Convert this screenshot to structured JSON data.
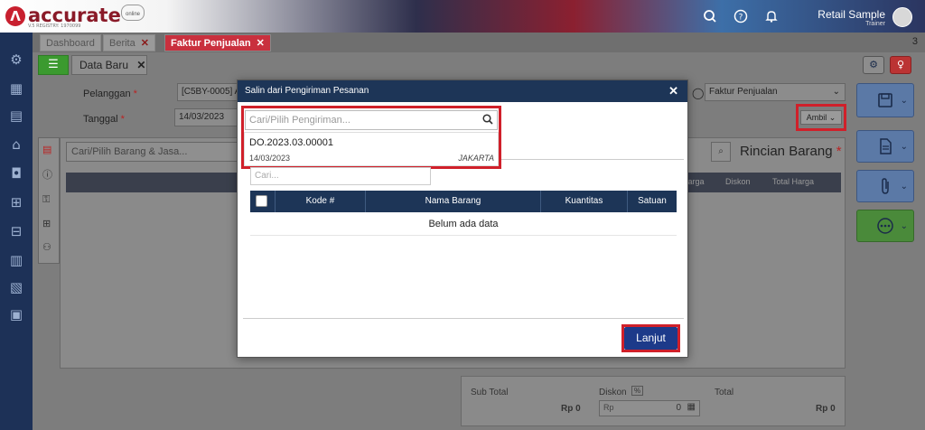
{
  "app": {
    "logo_text": "accurate",
    "logo_sub": "V.5 REGISTRY: 1970099",
    "logo_online": "online",
    "user_name": "Retail Sample",
    "user_role": "Trainer"
  },
  "tabs": [
    {
      "label": "Dashboard",
      "closable": false
    },
    {
      "label": "Berita",
      "closable": true
    },
    {
      "label": "Faktur Penjualan",
      "closable": true,
      "active": true
    }
  ],
  "tab_count": "3",
  "form": {
    "subtab_label": "Data Baru",
    "customer_label": "Pelanggan",
    "customer_value": "[C5BY-0005] Ab",
    "date_label": "Tanggal",
    "date_value": "14/03/2023",
    "doc_type_value": "Faktur Penjualan",
    "ambil_label": "Ambil",
    "item_search_placeholder": "Cari/Pilih Barang & Jasa...",
    "rincian_label": "Rincian Barang",
    "col_harga": "Harga",
    "col_diskon": "Diskon",
    "col_total": "Total Harga"
  },
  "summary": {
    "subtotal_label": "Sub Total",
    "subtotal_value": "Rp 0",
    "diskon_label": "Diskon",
    "diskon_badge": "%",
    "diskon_prefix": "Rp",
    "diskon_value": "0",
    "total_label": "Total",
    "total_value": "Rp 0"
  },
  "modal": {
    "title": "Salin dari Pengiriman Pesanan",
    "search_placeholder": "Cari/Pilih Pengiriman...",
    "result": {
      "code": "DO.2023.03.00001",
      "date": "14/03/2023",
      "location": "JAKARTA"
    },
    "cari_placeholder": "Cari...",
    "columns": [
      "Kode #",
      "Nama Barang",
      "Kuantitas",
      "Satuan"
    ],
    "empty_text": "Belum ada data",
    "continue_label": "Lanjut"
  },
  "colors": {
    "navy": "#1d3557",
    "accent_red": "#c9303e",
    "highlight_red": "#d0202a",
    "button_blue": "#1d3a8a"
  }
}
